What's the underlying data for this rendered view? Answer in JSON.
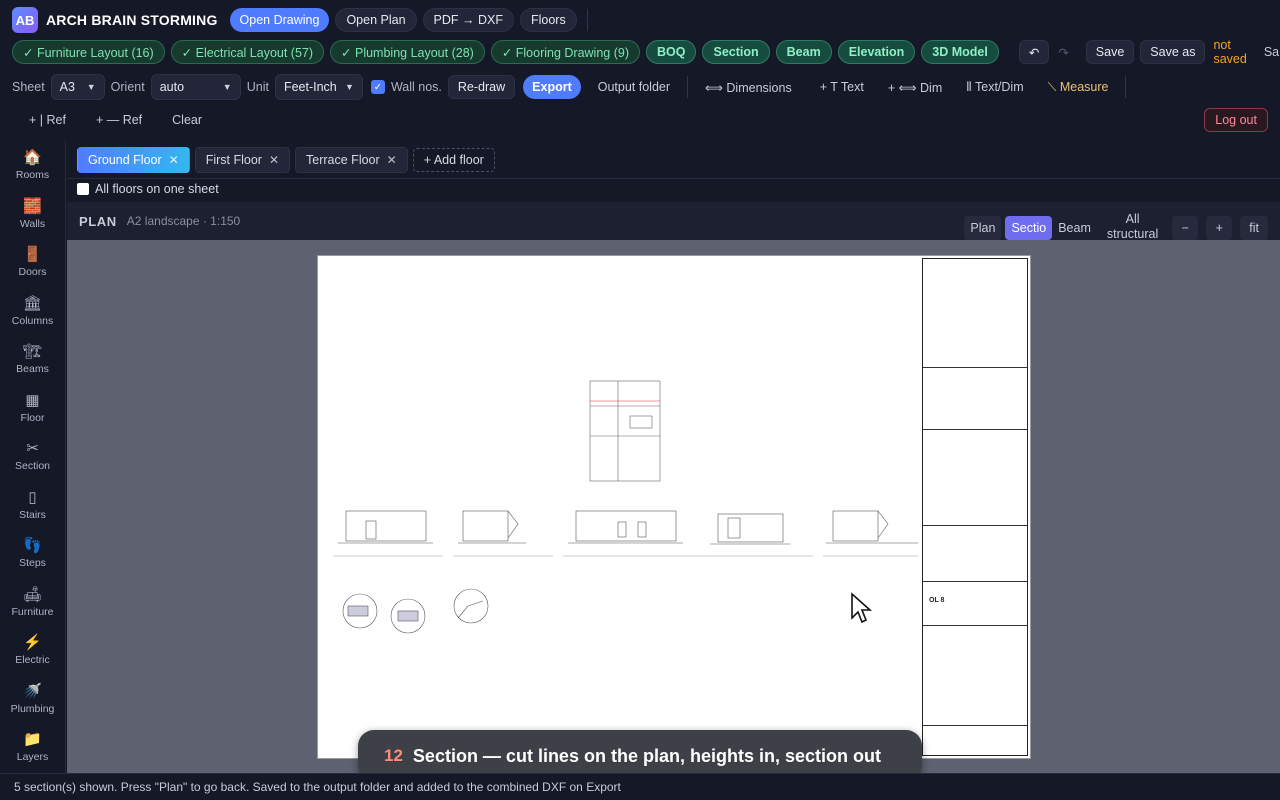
{
  "app": {
    "logo": "AB",
    "name": "ARCH BRAIN STORMING"
  },
  "nav": [
    "Open Drawing",
    "Open Plan",
    "PDF → DXF",
    "Floors"
  ],
  "layouts": [
    "✓ Furniture Layout (16)",
    "✓ Electrical Layout (57)",
    "✓ Plumbing Layout (28)",
    "✓ Flooring Drawing (9)"
  ],
  "modes": [
    "BOQ",
    "Section",
    "Beam",
    "Elevation",
    "3D Model"
  ],
  "history": {
    "undo_icon": "↶",
    "redo_icon": "↷"
  },
  "save": {
    "save": "Save",
    "save_as": "Save as",
    "status": "not saved",
    "sample": "Sample"
  },
  "sheet_controls": {
    "sheet_label": "Sheet",
    "sheet_value": "A3",
    "orient_label": "Orient",
    "orient_value": "auto",
    "unit_label": "Unit",
    "unit_value": "Feet-Inch",
    "wall_nos": "Wall nos.",
    "redraw": "Re-draw",
    "export": "Export",
    "output_folder": "Output folder"
  },
  "tools": [
    "⟺ Dimensions",
    "+ T Text",
    "+ ⟺ Dim",
    "⦀ Text/Dim",
    "⟍ Measure"
  ],
  "ref_tools": [
    "+ | Ref",
    "+ — Ref",
    "Clear"
  ],
  "logout": "Log out",
  "sidebar": [
    {
      "icon": "🏠",
      "label": "Rooms"
    },
    {
      "icon": "🧱",
      "label": "Walls"
    },
    {
      "icon": "🚪",
      "label": "Doors"
    },
    {
      "icon": "🏛",
      "label": "Columns"
    },
    {
      "icon": "🏗",
      "label": "Beams"
    },
    {
      "icon": "▦",
      "label": "Floor"
    },
    {
      "icon": "✂",
      "label": "Section"
    },
    {
      "icon": "▯",
      "label": "Stairs"
    },
    {
      "icon": "👣",
      "label": "Steps"
    },
    {
      "icon": "🛋",
      "label": "Furniture"
    },
    {
      "icon": "⚡",
      "label": "Electric"
    },
    {
      "icon": "🚿",
      "label": "Plumbing"
    },
    {
      "icon": "📁",
      "label": "Layers"
    }
  ],
  "floors": [
    {
      "label": "Ground Floor",
      "active": true
    },
    {
      "label": "First Floor",
      "active": false
    },
    {
      "label": "Terrace Floor",
      "active": false
    }
  ],
  "add_floor": "+ Add floor",
  "all_floors": "All floors on one sheet",
  "plan_header": {
    "title": "PLAN",
    "subtitle": "A2 landscape · 1:150",
    "views": [
      "Plan",
      "Sectio",
      "Beam"
    ],
    "all_structural": [
      "All",
      "structural"
    ],
    "zoom_out": "−",
    "zoom_in": "+",
    "fit": "fit"
  },
  "titleblock": {
    "drawing_no": "OL 8"
  },
  "toast": {
    "step": "12",
    "message": "Section — cut lines on the plan, heights in, section out"
  },
  "status": "5 section(s) shown. Press \"Plan\" to go back. Saved to the output folder and added to the combined DXF on Export"
}
